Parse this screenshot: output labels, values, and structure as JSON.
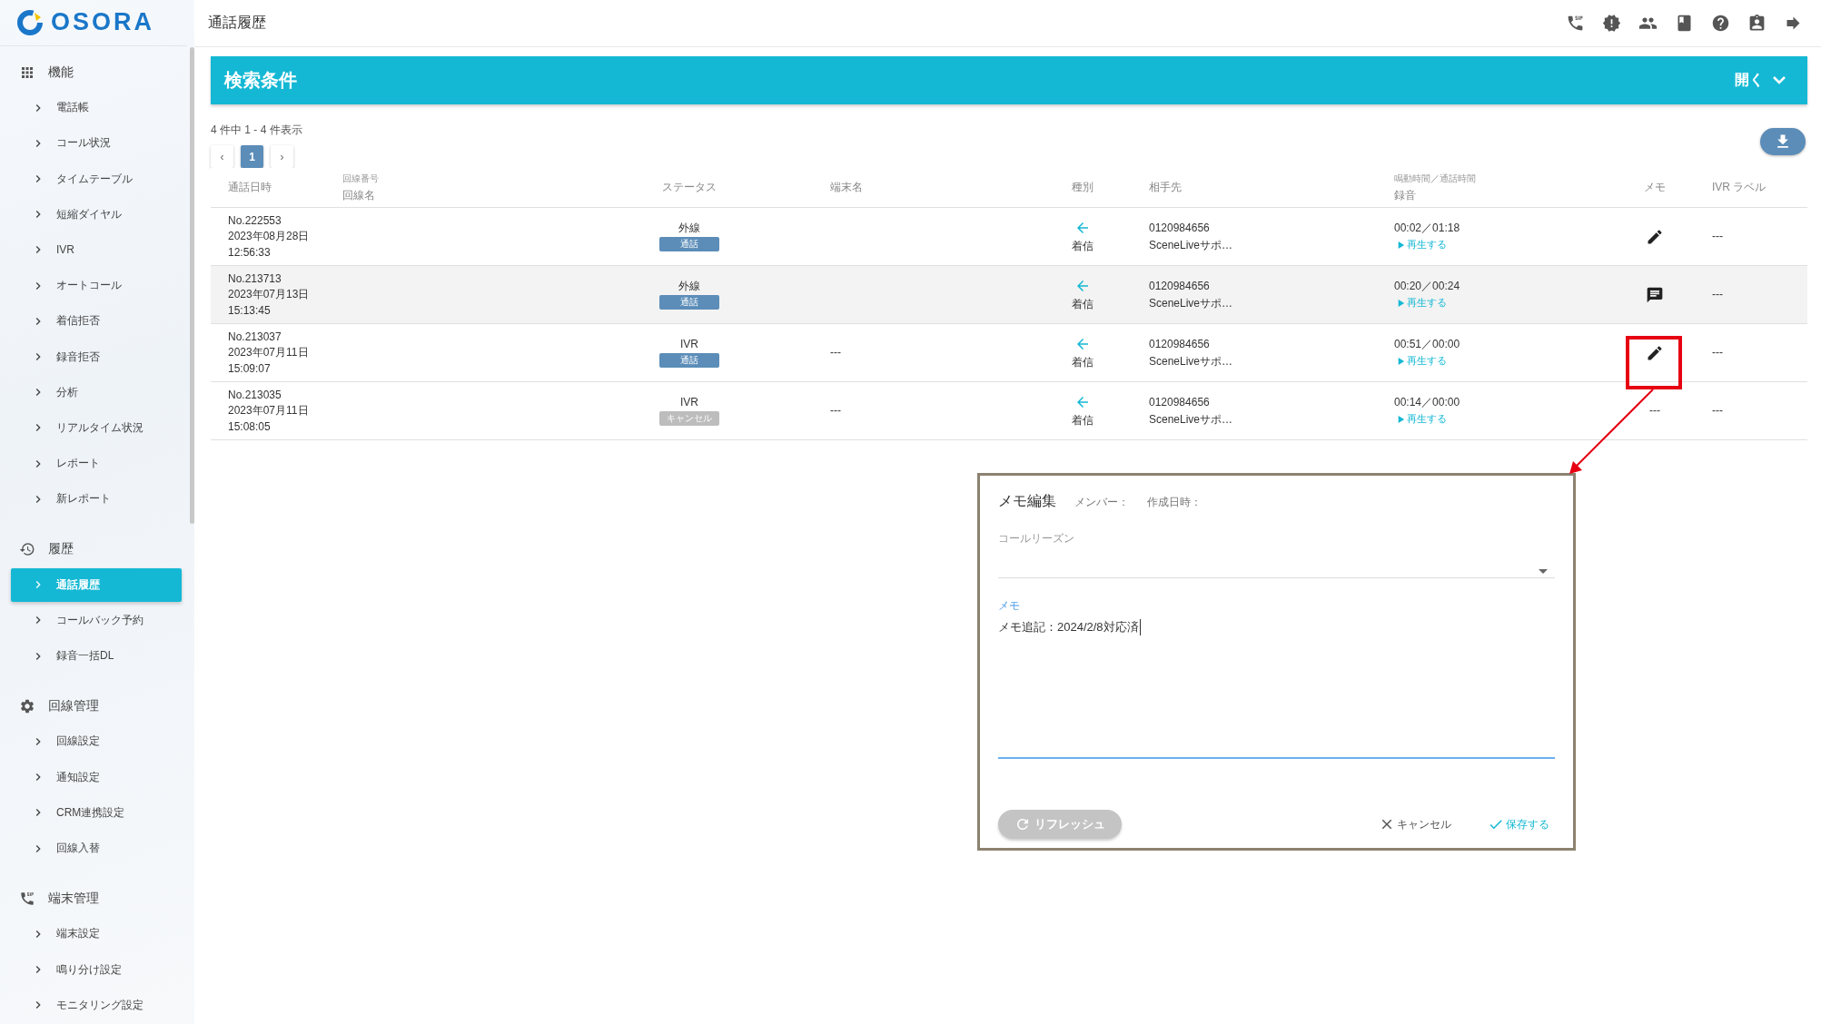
{
  "logo": {
    "text": "OSORA"
  },
  "header": {
    "title": "通話履歴"
  },
  "sidebar": {
    "sections": [
      {
        "title": "機能",
        "items": [
          {
            "label": "電話帳",
            "selected": false
          },
          {
            "label": "コール状況",
            "selected": false
          },
          {
            "label": "タイムテーブル",
            "selected": false
          },
          {
            "label": "短縮ダイヤル",
            "selected": false
          },
          {
            "label": "IVR",
            "selected": false
          },
          {
            "label": "オートコール",
            "selected": false
          },
          {
            "label": "着信拒否",
            "selected": false
          },
          {
            "label": "録音拒否",
            "selected": false
          },
          {
            "label": "分析",
            "selected": false
          },
          {
            "label": "リアルタイム状況",
            "selected": false
          },
          {
            "label": "レポート",
            "selected": false
          },
          {
            "label": "新レポート",
            "selected": false
          }
        ]
      },
      {
        "title": "履歴",
        "items": [
          {
            "label": "通話履歴",
            "selected": true
          },
          {
            "label": "コールバック予約",
            "selected": false
          },
          {
            "label": "録音一括DL",
            "selected": false
          }
        ]
      },
      {
        "title": "回線管理",
        "items": [
          {
            "label": "回線設定",
            "selected": false
          },
          {
            "label": "通知設定",
            "selected": false
          },
          {
            "label": "CRM連携設定",
            "selected": false
          },
          {
            "label": "回線入替",
            "selected": false
          }
        ]
      },
      {
        "title": "端末管理",
        "items": [
          {
            "label": "端末設定",
            "selected": false
          },
          {
            "label": "鳴り分け設定",
            "selected": false
          },
          {
            "label": "モニタリング設定",
            "selected": false
          }
        ]
      }
    ]
  },
  "search_panel": {
    "title": "検索条件",
    "toggle": "開く"
  },
  "summary": "4 件中 1 - 4 件表示",
  "pagination": {
    "prev": "‹",
    "pages": [
      {
        "label": "1",
        "selected": true
      }
    ],
    "next": "›"
  },
  "table": {
    "columns": {
      "datetime": "通話日時",
      "line_number": "回線番号",
      "line_name": "回線名",
      "status": "ステータス",
      "terminal": "端末名",
      "kind": "種別",
      "peer": "相手先",
      "duration": "鳴動時間／通話時間",
      "recording": "録音",
      "memo": "メモ",
      "ivr_label": "IVR ラベル"
    },
    "rows": [
      {
        "selected": false,
        "no": "No.222553",
        "date": "2023年08月28日",
        "time": "12:56:33",
        "route": "外線",
        "status": {
          "label": "通話",
          "color": "#5b8db8"
        },
        "terminal": "",
        "direction": "着信",
        "number": "0120984656",
        "name": "SceneLiveサポ…",
        "duration": "00:02／01:18",
        "play": "再生する",
        "memo": {
          "kind": "edit"
        },
        "ivr_label": "---"
      },
      {
        "selected": true,
        "no": "No.213713",
        "date": "2023年07月13日",
        "time": "15:13:45",
        "route": "外線",
        "status": {
          "label": "通話",
          "color": "#5b8db8"
        },
        "terminal": "",
        "direction": "着信",
        "number": "0120984656",
        "name": "SceneLiveサポ…",
        "duration": "00:20／00:24",
        "play": "再生する",
        "memo": {
          "kind": "note"
        },
        "ivr_label": "---"
      },
      {
        "selected": false,
        "no": "No.213037",
        "date": "2023年07月11日",
        "time": "15:09:07",
        "route": "IVR",
        "status": {
          "label": "通話",
          "color": "#5b8db8"
        },
        "terminal": "---",
        "direction": "着信",
        "number": "0120984656",
        "name": "SceneLiveサポ…",
        "duration": "00:51／00:00",
        "play": "再生する",
        "memo": {
          "kind": "edit"
        },
        "ivr_label": "---"
      },
      {
        "selected": false,
        "no": "No.213035",
        "date": "2023年07月11日",
        "time": "15:08:05",
        "route": "IVR",
        "status": {
          "label": "キャンセル",
          "color": "#bdbdbd"
        },
        "terminal": "---",
        "direction": "着信",
        "number": "0120984656",
        "name": "SceneLiveサポ…",
        "duration": "00:14／00:00",
        "play": "再生する",
        "memo": {
          "kind": "none",
          "text": "---"
        },
        "ivr_label": "---"
      }
    ]
  },
  "memo_dialog": {
    "title": "メモ編集",
    "member_label": "メンバー：",
    "created_label": "作成日時：",
    "reason_label": "コールリーズン",
    "memo_label": "メモ",
    "memo_value": "メモ追記：2024/2/8対応済",
    "refresh": {
      "label": "リフレッシュ",
      "disabled": true
    },
    "cancel": "キャンセル",
    "save": "保存する"
  }
}
